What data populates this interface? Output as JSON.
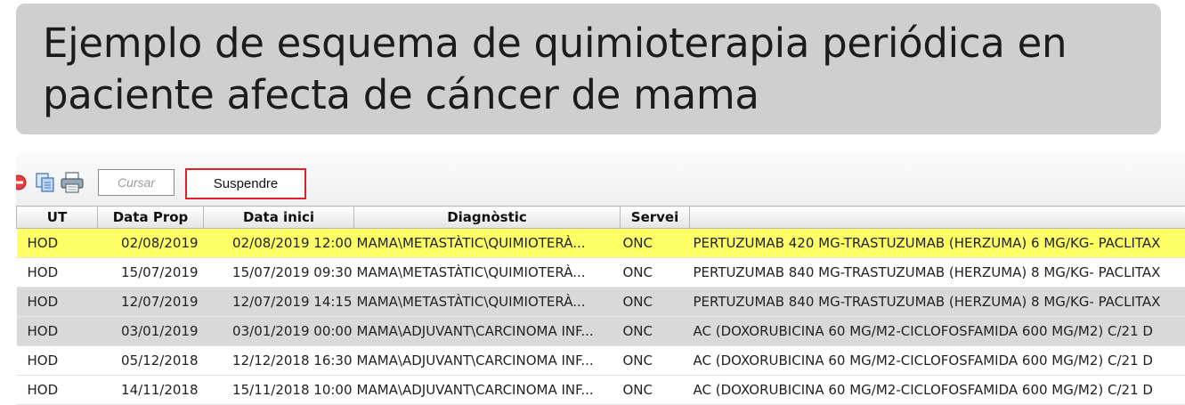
{
  "title": {
    "line1": "Ejemplo de esquema de quimioterapia periódica en",
    "line2": "paciente afecta de cáncer de mama"
  },
  "toolbar": {
    "cursar_label": "Cursar",
    "suspendre_label": "Suspendre",
    "icons": [
      "stop-icon",
      "copy-icon",
      "print-icon"
    ]
  },
  "table": {
    "columns": [
      "UT",
      "Data Prop",
      "Data inici",
      "Diagnòstic",
      "Servei",
      ""
    ],
    "rows": [
      {
        "ut": "HOD",
        "data_prop": "02/08/2019",
        "data_inici": "02/08/2019 12:00",
        "diagnostic": "MAMA\\METASTÀTIC\\QUIMIOTERÀ...",
        "servei": "ONC",
        "tractament": "PERTUZUMAB 420 MG-TRASTUZUMAB (HERZUMA) 6 MG/KG- PACLITAX"
      },
      {
        "ut": "HOD",
        "data_prop": "15/07/2019",
        "data_inici": "15/07/2019 09:30",
        "diagnostic": "MAMA\\METASTÀTIC\\QUIMIOTERÀ...",
        "servei": "ONC",
        "tractament": "PERTUZUMAB 840 MG-TRASTUZUMAB (HERZUMA) 8 MG/KG- PACLITAX"
      },
      {
        "ut": "HOD",
        "data_prop": "12/07/2019",
        "data_inici": "12/07/2019 14:15",
        "diagnostic": "MAMA\\METASTÀTIC\\QUIMIOTERÀ...",
        "servei": "ONC",
        "tractament": "PERTUZUMAB 840 MG-TRASTUZUMAB (HERZUMA) 8 MG/KG- PACLITAX"
      },
      {
        "ut": "HOD",
        "data_prop": "03/01/2019",
        "data_inici": "03/01/2019 00:00",
        "diagnostic": "MAMA\\ADJUVANT\\CARCINOMA INF...",
        "servei": "ONC",
        "tractament": "AC (DOXORUBICINA 60 MG/M2-CICLOFOSFAMIDA 600 MG/M2) C/21 D"
      },
      {
        "ut": "HOD",
        "data_prop": "05/12/2018",
        "data_inici": "12/12/2018 16:30",
        "diagnostic": "MAMA\\ADJUVANT\\CARCINOMA INF...",
        "servei": "ONC",
        "tractament": "AC (DOXORUBICINA 60 MG/M2-CICLOFOSFAMIDA 600 MG/M2) C/21 D"
      },
      {
        "ut": "HOD",
        "data_prop": "14/11/2018",
        "data_inici": "15/11/2018 10:00",
        "diagnostic": "MAMA\\ADJUVANT\\CARCINOMA INF...",
        "servei": "ONC",
        "tractament": "AC (DOXORUBICINA 60 MG/M2-CICLOFOSFAMIDA 600 MG/M2) C/21 D"
      }
    ]
  },
  "colors": {
    "selected_row": "#ffff66",
    "shaded_row": "#d9d9d9",
    "highlight_border": "#e0202a",
    "title_background": "#cfcfcf"
  }
}
